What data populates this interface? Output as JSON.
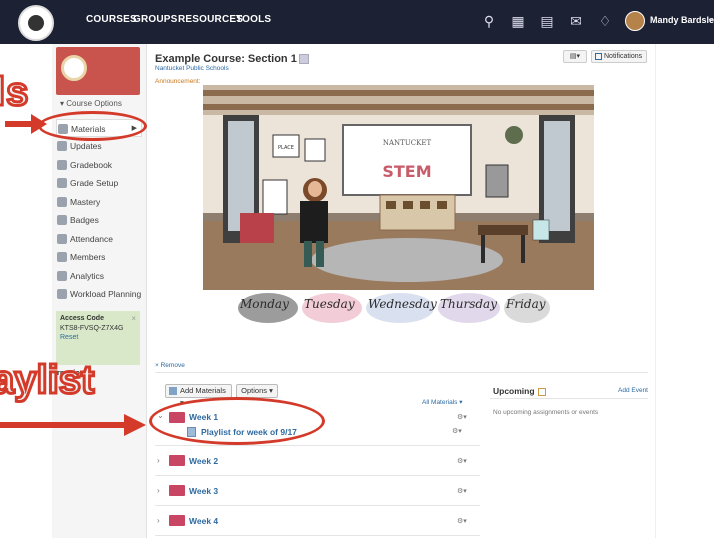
{
  "nav": {
    "courses": "COURSES",
    "groups": "GROUPS",
    "resources": "RESOURCES",
    "tools": "TOOLS",
    "user_name": "Mandy Bardsley"
  },
  "callouts": {
    "tools": "ls",
    "playlist": "aylist"
  },
  "sidebar": {
    "course_options": "Course Options",
    "items": [
      {
        "label": "Materials"
      },
      {
        "label": "Updates"
      },
      {
        "label": "Gradebook"
      },
      {
        "label": "Grade Setup"
      },
      {
        "label": "Mastery"
      },
      {
        "label": "Badges"
      },
      {
        "label": "Attendance"
      },
      {
        "label": "Members"
      },
      {
        "label": "Analytics"
      },
      {
        "label": "Workload Planning"
      }
    ],
    "access_code_label": "Access Code",
    "access_code": "KTS8-FVSQ-Z7X4G",
    "reset": "Reset",
    "info_fragment": "rmation"
  },
  "course": {
    "title": "Example Course: Section 1",
    "school": "Nantucket Public Schools",
    "announcement": "Announcement:",
    "notifications": "Notifications",
    "remove": "× Remove"
  },
  "classroom_image": {
    "sign": "NANTUCKET",
    "stem": "STEM",
    "place_sign": "PLACE",
    "days": [
      "Monday",
      "Tuesday",
      "Wednesday",
      "Thursday",
      "Friday"
    ]
  },
  "materials": {
    "add_materials": "Add Materials",
    "options": "Options",
    "all_materials": "All Materials",
    "folders": [
      {
        "label": "Week 1"
      },
      {
        "label": "Week 2"
      },
      {
        "label": "Week 3"
      },
      {
        "label": "Week 4"
      }
    ],
    "playlist_item": "Playlist for week of 9/17"
  },
  "upcoming": {
    "title": "Upcoming",
    "add_event": "Add Event",
    "empty": "No upcoming assignments or events"
  },
  "colors": {
    "topbar": "#1c2133",
    "link": "#2e6aa0",
    "folder": "#c94564",
    "callout_red": "#d43a2a"
  }
}
